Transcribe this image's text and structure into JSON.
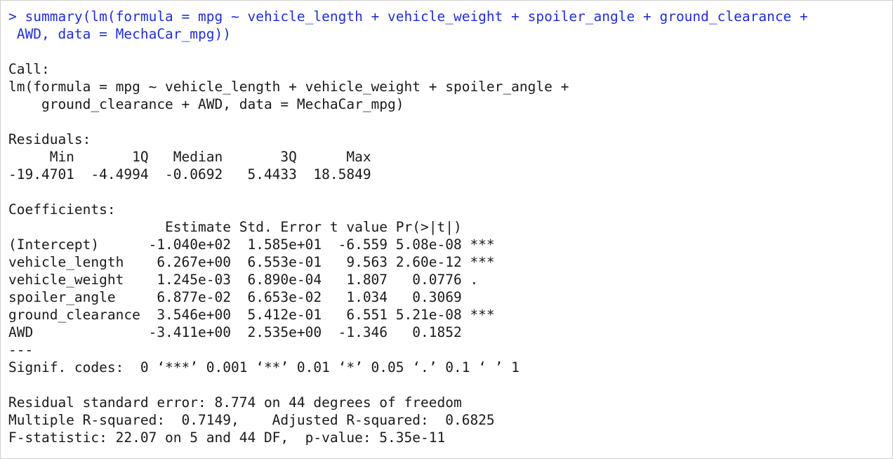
{
  "console": {
    "command": [
      "> summary(lm(formula = mpg ~ vehicle_length + vehicle_weight + spoiler_angle + ground_clearance +",
      " AWD, data = MechaCar_mpg))"
    ],
    "output": [
      "",
      "Call:",
      "lm(formula = mpg ~ vehicle_length + vehicle_weight + spoiler_angle + ",
      "    ground_clearance + AWD, data = MechaCar_mpg)",
      "",
      "Residuals:",
      "     Min       1Q   Median       3Q      Max ",
      "-19.4701  -4.4994  -0.0692   5.4433  18.5849 ",
      "",
      "Coefficients:",
      "                   Estimate Std. Error t value Pr(>|t|)    ",
      "(Intercept)      -1.040e+02  1.585e+01  -6.559 5.08e-08 ***",
      "vehicle_length    6.267e+00  6.553e-01   9.563 2.60e-12 ***",
      "vehicle_weight    1.245e-03  6.890e-04   1.807   0.0776 .  ",
      "spoiler_angle     6.877e-02  6.653e-02   1.034   0.3069    ",
      "ground_clearance  3.546e+00  5.412e-01   6.551 5.21e-08 ***",
      "AWD              -3.411e+00  2.535e+00  -1.346   0.1852    ",
      "---",
      "Signif. codes:  0 ‘***’ 0.001 ‘**’ 0.01 ‘*’ 0.05 ‘.’ 0.1 ‘ ’ 1",
      "",
      "Residual standard error: 8.774 on 44 degrees of freedom",
      "Multiple R-squared:  0.7149,\tAdjusted R-squared:  0.6825 ",
      "F-statistic: 22.07 on 5 and 44 DF,  p-value: 5.35e-11"
    ]
  },
  "colors": {
    "command": "#1f2fd6",
    "output": "#1a1a1a",
    "background": "#ffffff",
    "border": "#cfcfcf"
  }
}
